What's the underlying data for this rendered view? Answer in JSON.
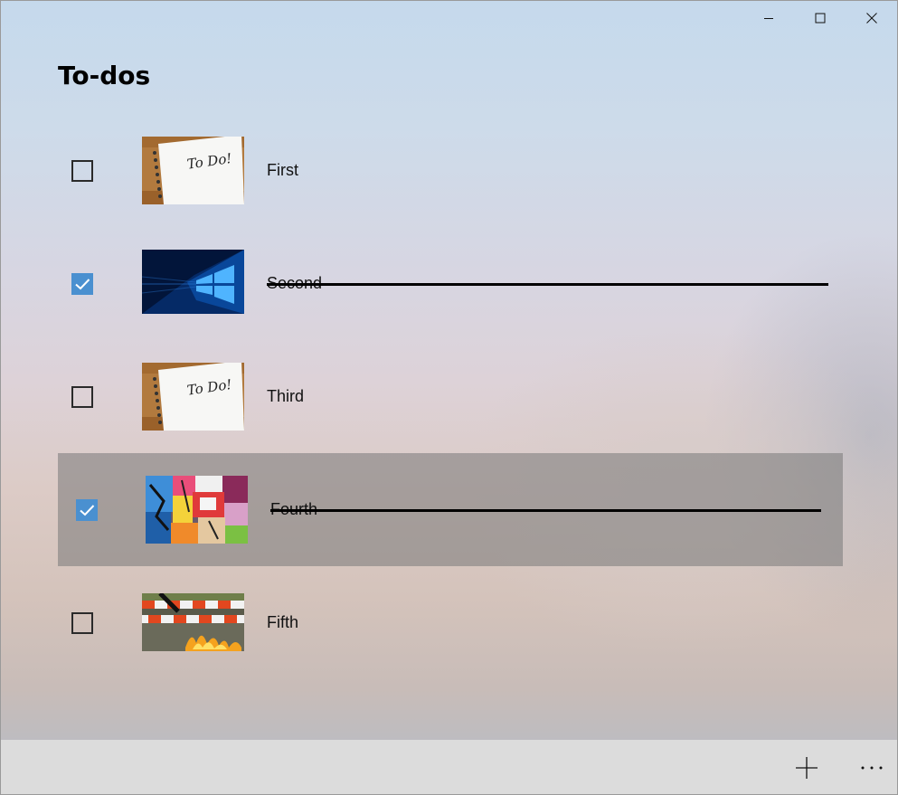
{
  "page": {
    "title": "To-dos"
  },
  "todos": [
    {
      "label": "First",
      "completed": false,
      "image": "todo-notepad"
    },
    {
      "label": "Second",
      "completed": true,
      "image": "windows-logo"
    },
    {
      "label": "Third",
      "completed": false,
      "image": "todo-notepad"
    },
    {
      "label": "Fourth",
      "completed": true,
      "image": "graffiti-wall",
      "selected": true
    },
    {
      "label": "Fifth",
      "completed": false,
      "image": "road-barrier-fire"
    }
  ],
  "toolbar": {
    "add_icon": "plus-icon",
    "more_icon": "more-ellipsis-icon"
  },
  "colors": {
    "checkbox_checked": "#4a90d0",
    "selected_row": "#787878",
    "bottom_bar": "#dcdcdc"
  }
}
